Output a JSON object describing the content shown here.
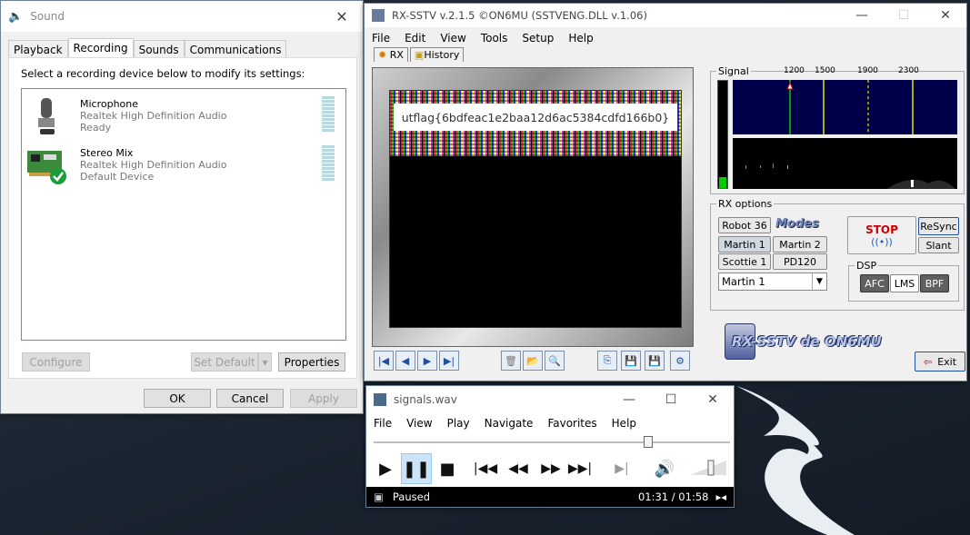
{
  "sound": {
    "title": "Sound",
    "tabs": [
      "Playback",
      "Recording",
      "Sounds",
      "Communications"
    ],
    "instruction": "Select a recording device below to modify its settings:",
    "devices": [
      {
        "name": "Microphone",
        "driver": "Realtek High Definition Audio",
        "status": "Ready"
      },
      {
        "name": "Stereo Mix",
        "driver": "Realtek High Definition Audio",
        "status": "Default Device"
      }
    ],
    "configure": "Configure",
    "set_default": "Set Default",
    "properties": "Properties",
    "ok": "OK",
    "cancel": "Cancel",
    "apply": "Apply"
  },
  "rx": {
    "title": "RX-SSTV v.2.1.5 ©ON6MU (SSTVENG.DLL v.1.06)",
    "menu": [
      "File",
      "Edit",
      "View",
      "Tools",
      "Setup",
      "Help"
    ],
    "tabs": [
      "RX",
      "History"
    ],
    "image_text": "utflag{6bdfeac1e2baa12d6ac5384cdfd166b0}",
    "signal_label": "Signal",
    "freqs": [
      "1200",
      "1500",
      "1900",
      "2300"
    ],
    "rx_options": "RX options",
    "modes": [
      "Robot 36",
      "Martin 1",
      "Martin 2",
      "Scottie 1",
      "PD120"
    ],
    "modes_logo": "Modes",
    "mode_select": "Martin 1",
    "stop": "STOP",
    "resync": "ReSync",
    "slant": "Slant",
    "dsp": "DSP",
    "afc": "AFC",
    "lms": "LMS",
    "bpf": "BPF",
    "logo": "RX-SSTV de ON6MU",
    "exit": "Exit"
  },
  "wmp": {
    "title": "signals.wav",
    "menu": [
      "File",
      "View",
      "Play",
      "Navigate",
      "Favorites",
      "Help"
    ],
    "status": "Paused",
    "time": "01:31 / 01:58",
    "progress": 0.77
  },
  "colors": {
    "accent": "#0078d7",
    "stop": "#cc0000",
    "signal_bg": "#000050",
    "marker": "#e0e000"
  }
}
